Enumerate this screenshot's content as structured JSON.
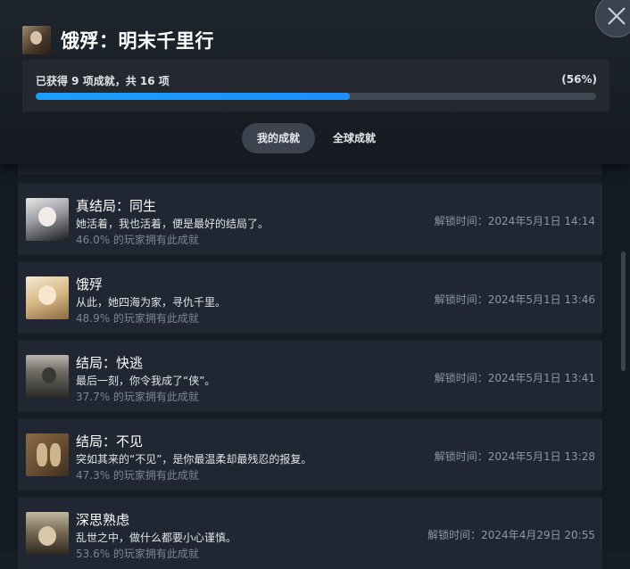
{
  "game": {
    "title": "饿殍：明末千里行",
    "icon": "game-cover-icon"
  },
  "progress": {
    "summary": "已获得 9 项成就，共 16 项",
    "percent_label": "(56%)",
    "fraction": 0.56
  },
  "tabs": {
    "mine": "我的成就",
    "global": "全球成就",
    "active": "mine"
  },
  "achievements": [
    {
      "name": "真结局：同生",
      "description": "她活着，我也活着，便是最好的结局了。",
      "global_pct": "46.0% 的玩家拥有此成就",
      "unlock_time": "解锁时间：2024年5月1日 14:14"
    },
    {
      "name": "饿殍",
      "description": "从此，她四海为家，寻仇千里。",
      "global_pct": "48.9% 的玩家拥有此成就",
      "unlock_time": "解锁时间：2024年5月1日 13:46"
    },
    {
      "name": "结局：快逃",
      "description": "最后一刻，你令我成了“侠”。",
      "global_pct": "37.7% 的玩家拥有此成就",
      "unlock_time": "解锁时间：2024年5月1日 13:41"
    },
    {
      "name": "结局：不见",
      "description": "突如其来的“不见”，是你最温柔却最残忍的报复。",
      "global_pct": "47.3% 的玩家拥有此成就",
      "unlock_time": "解锁时间：2024年5月1日 13:28"
    },
    {
      "name": "深思熟虑",
      "description": "乱世之中，做什么都要小心谨慎。",
      "global_pct": "53.6% 的玩家拥有此成就",
      "unlock_time": "解锁时间：2024年4月29日 20:55"
    }
  ],
  "colors": {
    "accent": "#1a9fff",
    "card_bg": "#202632",
    "page_bg": "#171d25"
  }
}
